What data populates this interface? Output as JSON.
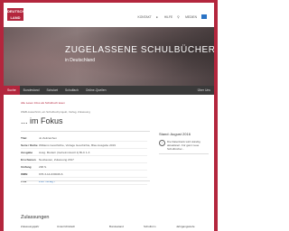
{
  "logo": {
    "line1": "DEUTSCH",
    "line2": "LAND"
  },
  "top_links": {
    "link1": "KONTAKT",
    "link2": "HILFE",
    "link3": "MEDIEN"
  },
  "hero": {
    "title": "ZUGELASSENE SCHULBÜCHER",
    "subtitle": "in Deutschland"
  },
  "nav": {
    "items": [
      "Suche",
      "Bundesland",
      "Schulart",
      "Schulfach",
      "Online-Quellen"
    ],
    "right": "Über Uns"
  },
  "breadcrumb": "Alle Lesen Infos als Schulbuch lesen",
  "subtitle": "WEB-Ausschnitt, ein Schulbuchprojekt, Verlag, Zulassung",
  "heading": "... im Fokus",
  "meta": [
    {
      "key": "Titel",
      "value": "Jo Zeitzeichen",
      "link": false
    },
    {
      "key": "Serie / Reihe",
      "value": "Williams Geschichte, Vorlage Geschichte, Blau Ausgabe 2019",
      "link": false
    },
    {
      "key": "Ausgabe",
      "value": "Ausg. Modern (Geheimnisvoll 1) BLC 1-3",
      "link": false
    },
    {
      "key": "Erschienen",
      "value": "Neubauten, Zulassung 2017",
      "link": false
    },
    {
      "key": "Umfang",
      "value": "296 S.",
      "link": false
    },
    {
      "key": "ISBN",
      "value": "978-3-14-030046-6",
      "link": false
    },
    {
      "key": "Link",
      "value": "Zum Verlag ›",
      "link": true
    }
  ],
  "side": {
    "stand": "Stand: August 2016",
    "note": "Die Datenbank wird ständig aktualisiert. Für ganz neue Schulbücher..."
  },
  "section": {
    "title": "Zulassungen"
  },
  "table_headers": [
    "Zulassungsjahr",
    "Unterrichtsfach",
    "Bundesland",
    "Schulform",
    "Jahrgangsstufe"
  ],
  "colors": {
    "brand": "#b3263d",
    "nav_bg": "#3a3a3a",
    "link": "#2a73c5"
  }
}
